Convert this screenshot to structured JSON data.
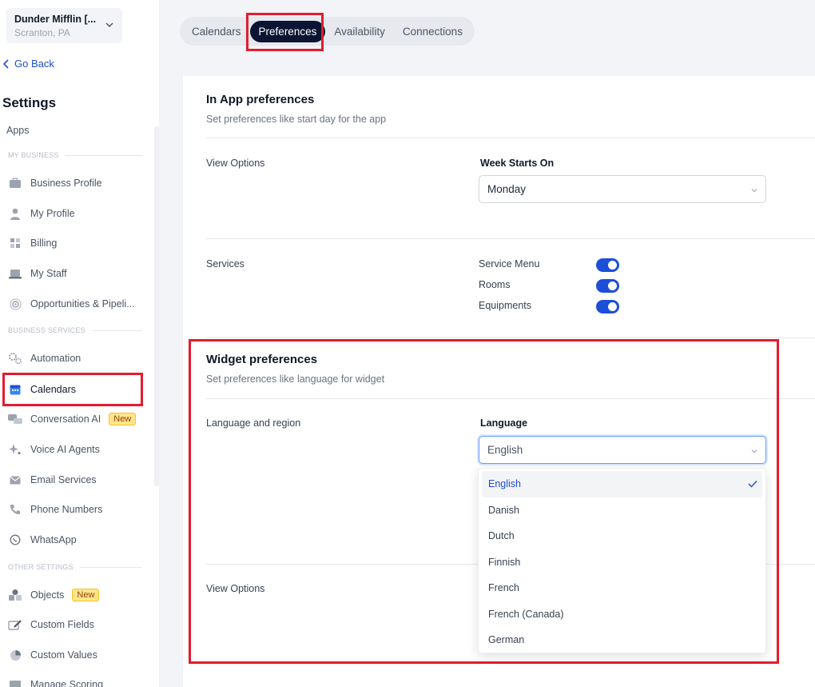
{
  "location": {
    "name": "Dunder Mifflin [...",
    "city": "Scranton, PA"
  },
  "sidebar": {
    "go_back": "Go Back",
    "title": "Settings",
    "apps": "Apps",
    "sections": {
      "my_business": "MY BUSINESS",
      "business_services": "BUSINESS SERVICES",
      "other_settings": "OTHER SETTINGS"
    },
    "items": {
      "business_profile": "Business Profile",
      "my_profile": "My Profile",
      "billing": "Billing",
      "my_staff": "My Staff",
      "opportunities": "Opportunities & Pipeli...",
      "automation": "Automation",
      "calendars": "Calendars",
      "conversation_ai": "Conversation AI",
      "voice_ai": "Voice AI Agents",
      "email_services": "Email Services",
      "phone_numbers": "Phone Numbers",
      "whatsapp": "WhatsApp",
      "objects": "Objects",
      "custom_fields": "Custom Fields",
      "custom_values": "Custom Values",
      "cut_off": "Manage Scoring"
    },
    "badge_new": "New"
  },
  "tabs": {
    "calendars": "Calendars",
    "preferences": "Preferences",
    "availability": "Availability",
    "connections": "Connections"
  },
  "in_app": {
    "title": "In App preferences",
    "subtitle": "Set preferences like start day for the app",
    "view_options": "View Options",
    "week_starts_label": "Week Starts On",
    "week_starts_value": "Monday",
    "services_label": "Services",
    "services": {
      "service_menu": "Service Menu",
      "rooms": "Rooms",
      "equipments": "Equipments"
    }
  },
  "widget": {
    "title": "Widget preferences",
    "subtitle": "Set preferences like language for widget",
    "language_region": "Language and region",
    "language_label": "Language",
    "language_value": "English",
    "view_options": "View Options",
    "options": [
      "English",
      "Danish",
      "Dutch",
      "Finnish",
      "French",
      "French (Canada)",
      "German"
    ]
  },
  "colors": {
    "accent": "#1d4ed8",
    "active_tab": "#0b1533",
    "highlight": "#e11d2e"
  }
}
